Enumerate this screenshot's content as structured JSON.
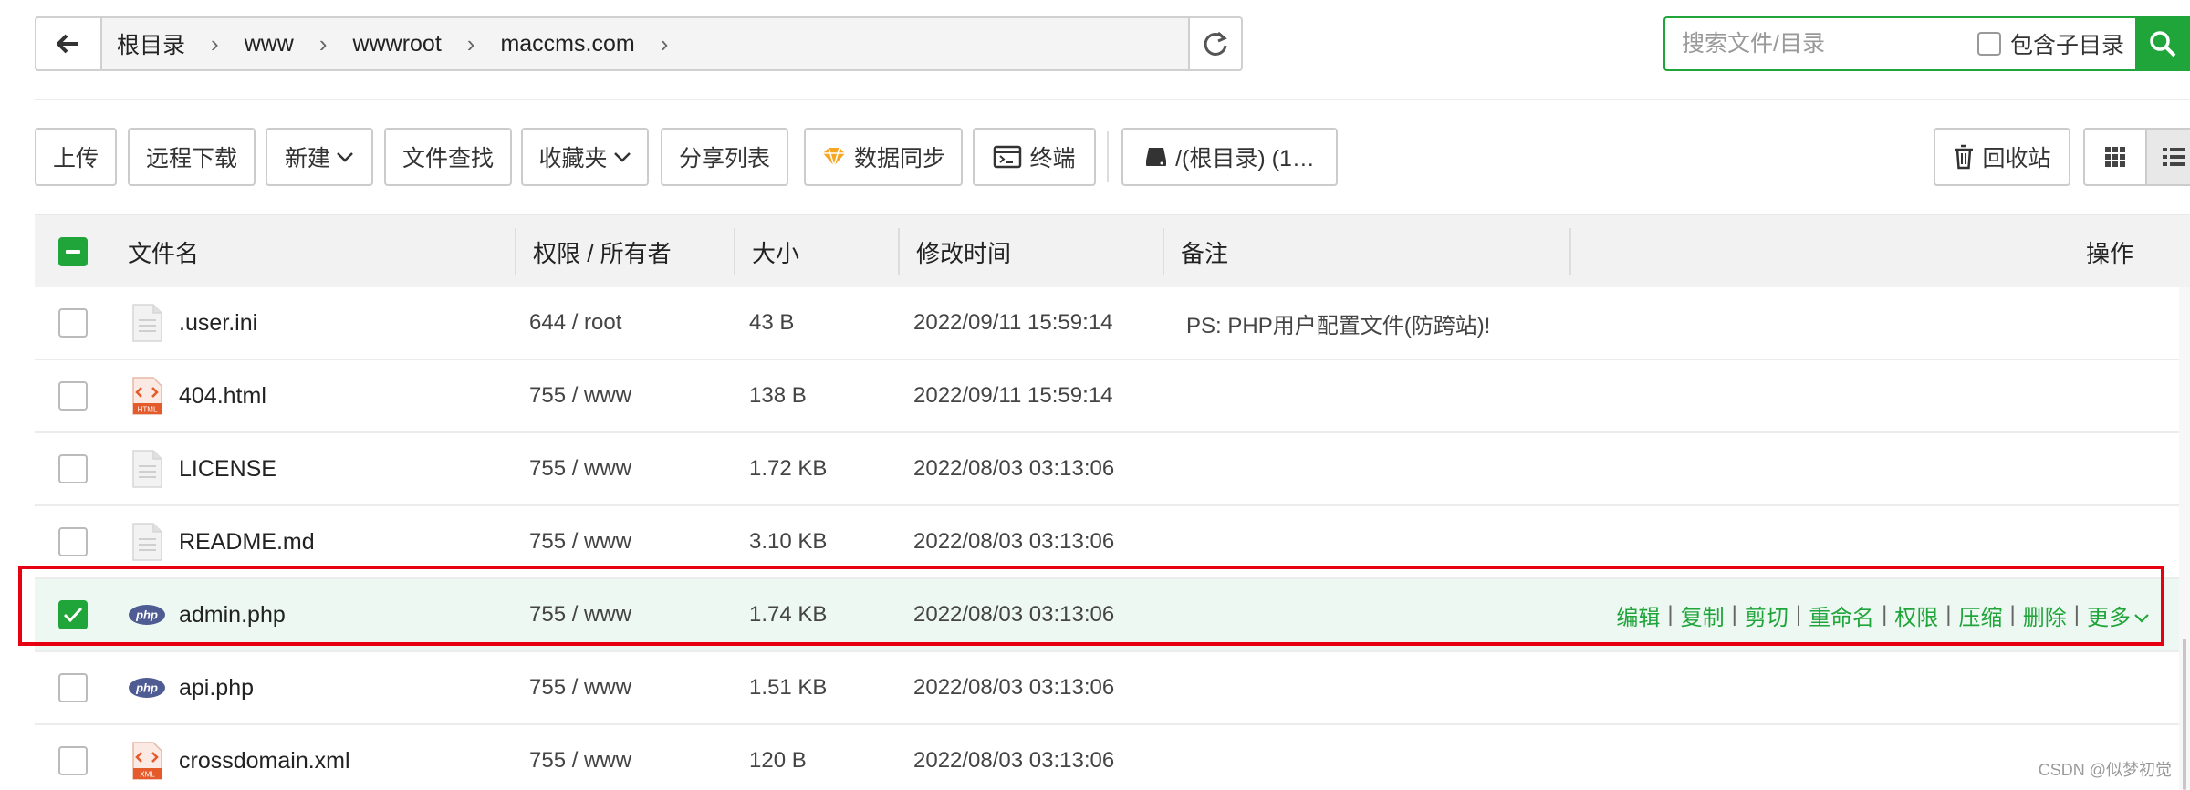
{
  "path": {
    "crumbs": [
      "根目录",
      "www",
      "wwwroot",
      "maccms.com"
    ]
  },
  "search": {
    "placeholder": "搜索文件/目录",
    "subdir_label": "包含子目录"
  },
  "toolbar": {
    "upload": "上传",
    "remote_download": "远程下载",
    "new": "新建",
    "file_search": "文件查找",
    "favorites": "收藏夹",
    "share_list": "分享列表",
    "data_sync": "数据同步",
    "terminal": "终端",
    "disk": "/(根目录) (1…",
    "recycle_bin": "回收站"
  },
  "table": {
    "headers": {
      "name": "文件名",
      "perm": "权限 / 所有者",
      "size": "大小",
      "mtime": "修改时间",
      "note": "备注",
      "ops": "操作"
    },
    "rows": [
      {
        "name": ".user.ini",
        "icon": "text-file-icon",
        "perm": "644 / root",
        "size": "43 B",
        "mtime": "2022/09/11 15:59:14",
        "note": "PS: PHP用户配置文件(防跨站)!"
      },
      {
        "name": "404.html",
        "icon": "html-file-icon",
        "icon_label": "HTML",
        "perm": "755 / www",
        "size": "138 B",
        "mtime": "2022/09/11 15:59:14",
        "note": ""
      },
      {
        "name": "LICENSE",
        "icon": "text-file-icon",
        "perm": "755 / www",
        "size": "1.72 KB",
        "mtime": "2022/08/03 03:13:06",
        "note": ""
      },
      {
        "name": "README.md",
        "icon": "text-file-icon",
        "perm": "755 / www",
        "size": "3.10 KB",
        "mtime": "2022/08/03 03:13:06",
        "note": ""
      },
      {
        "name": "admin.php",
        "icon": "php-file-icon",
        "icon_label": "php",
        "perm": "755 / www",
        "size": "1.74 KB",
        "mtime": "2022/08/03 03:13:06",
        "note": "",
        "selected": true
      },
      {
        "name": "api.php",
        "icon": "php-file-icon",
        "icon_label": "php",
        "perm": "755 / www",
        "size": "1.51 KB",
        "mtime": "2022/08/03 03:13:06",
        "note": ""
      },
      {
        "name": "crossdomain.xml",
        "icon": "xml-file-icon",
        "icon_label": "XML",
        "perm": "755 / www",
        "size": "120 B",
        "mtime": "2022/08/03 03:13:06",
        "note": ""
      }
    ],
    "row_ops": [
      "编辑",
      "复制",
      "剪切",
      "重命名",
      "权限",
      "压缩",
      "删除",
      "更多"
    ]
  },
  "watermark": "CSDN @似梦初觉",
  "colors": {
    "accent": "#20a53a",
    "highlight": "#e60012",
    "selected_row": "#eef8f3"
  }
}
